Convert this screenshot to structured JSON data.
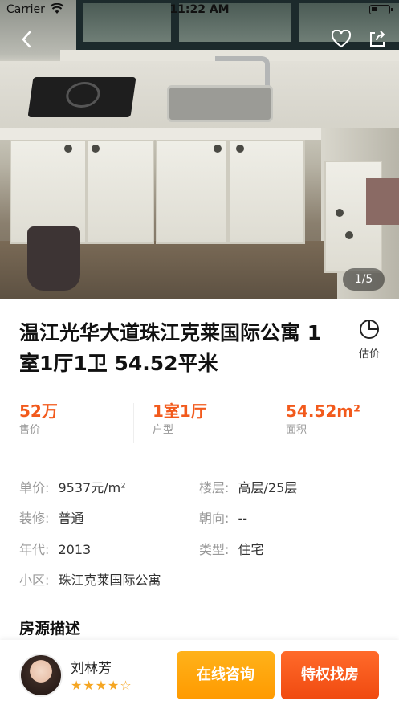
{
  "status_bar": {
    "carrier": "Carrier",
    "time": "11:22 AM"
  },
  "gallery": {
    "counter": "1/5"
  },
  "listing": {
    "title": "温江光华大道珠江克莱国际公寓 1室1厅1卫 54.52平米",
    "estimate_label": "估价"
  },
  "stats": [
    {
      "value": "52万",
      "label": "售价"
    },
    {
      "value": "1室1厅",
      "label": "户型"
    },
    {
      "value": "54.52m²",
      "label": "面积"
    }
  ],
  "details": {
    "unit_price_key": "单价:",
    "unit_price": "9537元/m²",
    "floor_key": "楼层:",
    "floor": "高层/25层",
    "decoration_key": "装修:",
    "decoration": "普通",
    "orientation_key": "朝向:",
    "orientation": "--",
    "year_key": "年代:",
    "year": "2013",
    "type_key": "类型:",
    "type": "住宅",
    "community_key": "小区:",
    "community": "珠江克莱国际公寓"
  },
  "description": {
    "heading": "房源描述"
  },
  "agent": {
    "name": "刘林芳",
    "rating": "★★★★☆",
    "rating_value": 4.5
  },
  "actions": {
    "consult_label": "在线咨询",
    "find_label": "特权找房"
  },
  "colors": {
    "accent": "#f25a1c",
    "consult_button": "#ffa60d",
    "find_button": "#f5571a",
    "star": "#f5a623"
  },
  "icons": [
    "back-icon",
    "heart-icon",
    "share-icon",
    "pie-chart-icon",
    "wifi-icon",
    "battery-icon"
  ]
}
